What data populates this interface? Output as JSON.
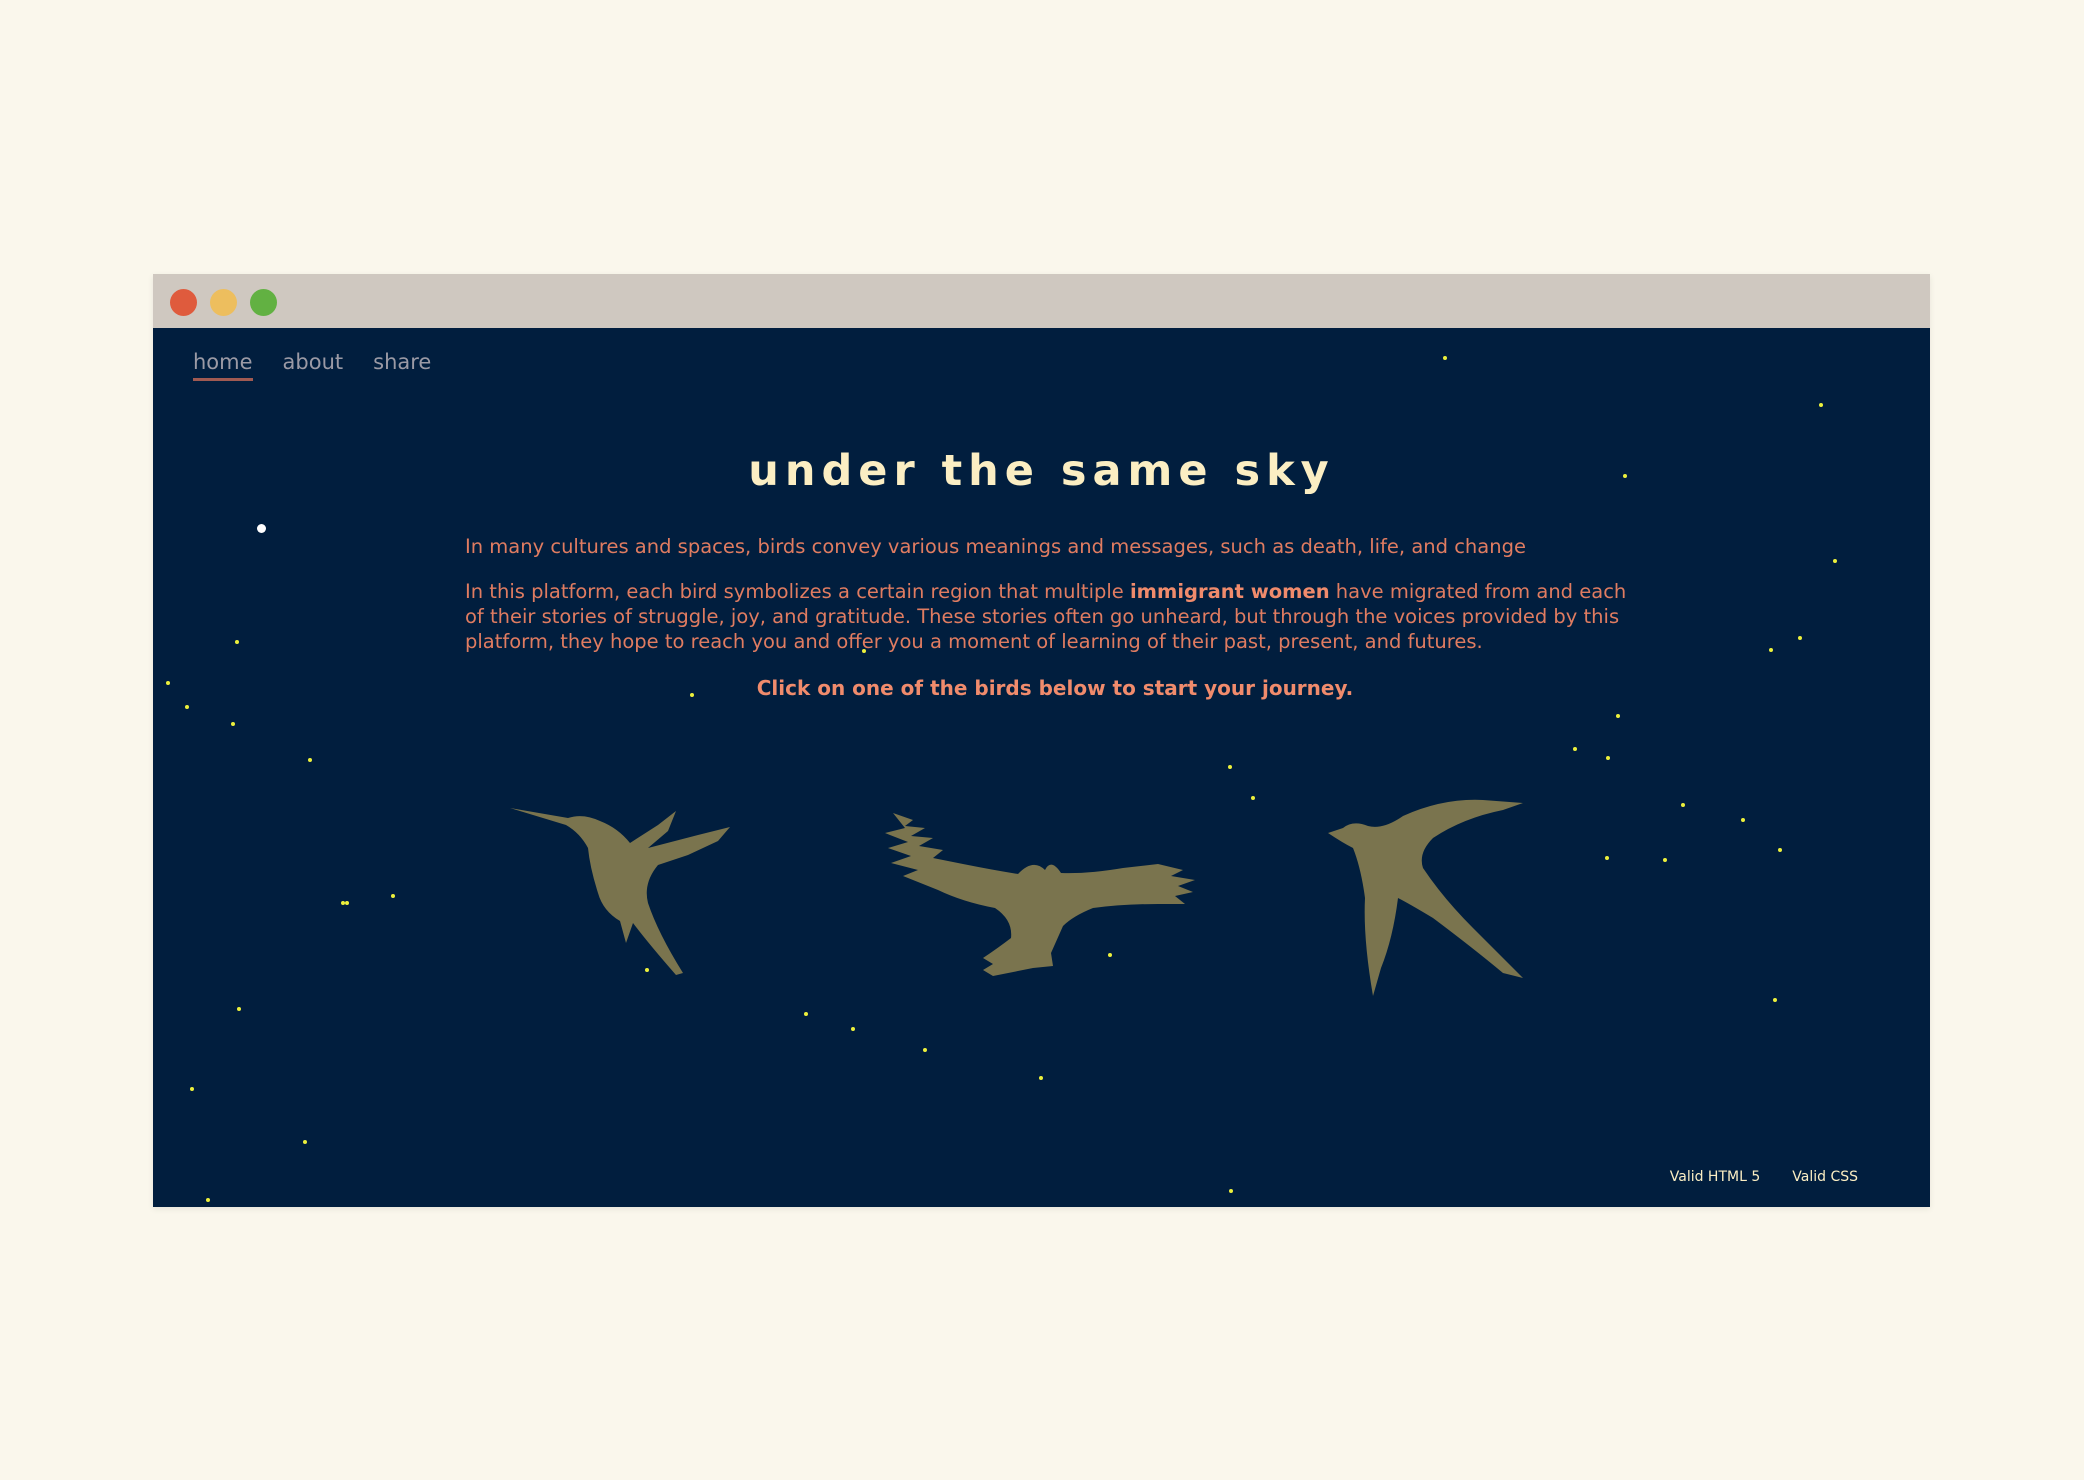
{
  "nav": {
    "items": [
      {
        "label": "home",
        "active": true
      },
      {
        "label": "about"
      },
      {
        "label": "share"
      }
    ]
  },
  "title": "under the same sky",
  "intro": {
    "p1": "In many cultures and spaces, birds convey various meanings and messages, such as death, life, and change",
    "p2_before": "In this platform, each bird symbolizes a certain region that multiple ",
    "p2_strong": "immigrant women",
    "p2_after": " have migrated from and each of their stories of struggle, joy, and gratitude. These stories often go unheard, but through the voices provided by this platform, they hope to reach you and offer you a moment of learning of their past, present, and futures.",
    "cta": "Click on one of the birds below to start your journey."
  },
  "birds": [
    {
      "name": "hummingbird"
    },
    {
      "name": "eagle"
    },
    {
      "name": "swallow"
    }
  ],
  "footer": {
    "html": "Valid HTML 5",
    "css": "Valid CSS"
  },
  "colors": {
    "background": "#011e3e",
    "bird": "#7a744e",
    "text": "#e07c61",
    "title": "#fbeec3",
    "star": "#ecf03c"
  }
}
